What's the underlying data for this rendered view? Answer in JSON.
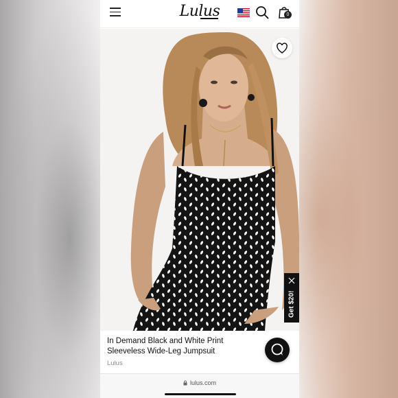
{
  "header": {
    "menu_icon": "hamburger-menu-icon",
    "logo_text": "Lulus",
    "flag_icon": "us-flag-icon",
    "search_icon": "search-icon",
    "bag_icon": "shopping-bag-icon",
    "bag_count": "0"
  },
  "product": {
    "image": "product-photo",
    "favorite_icon": "heart-icon",
    "title": "In Demand Black and White Print Sleeveless Wide-Leg Jumpsuit",
    "brand": "Lulus"
  },
  "promo": {
    "label": "Get $20!",
    "close_icon": "close-icon"
  },
  "chat": {
    "icon": "chat-bubble-icon"
  },
  "browser": {
    "url": "lulus.com",
    "lock_icon": "lock-icon"
  },
  "colors": {
    "accent": "#111111",
    "background": "#ffffff",
    "brand_text": "#8a8a8a"
  }
}
